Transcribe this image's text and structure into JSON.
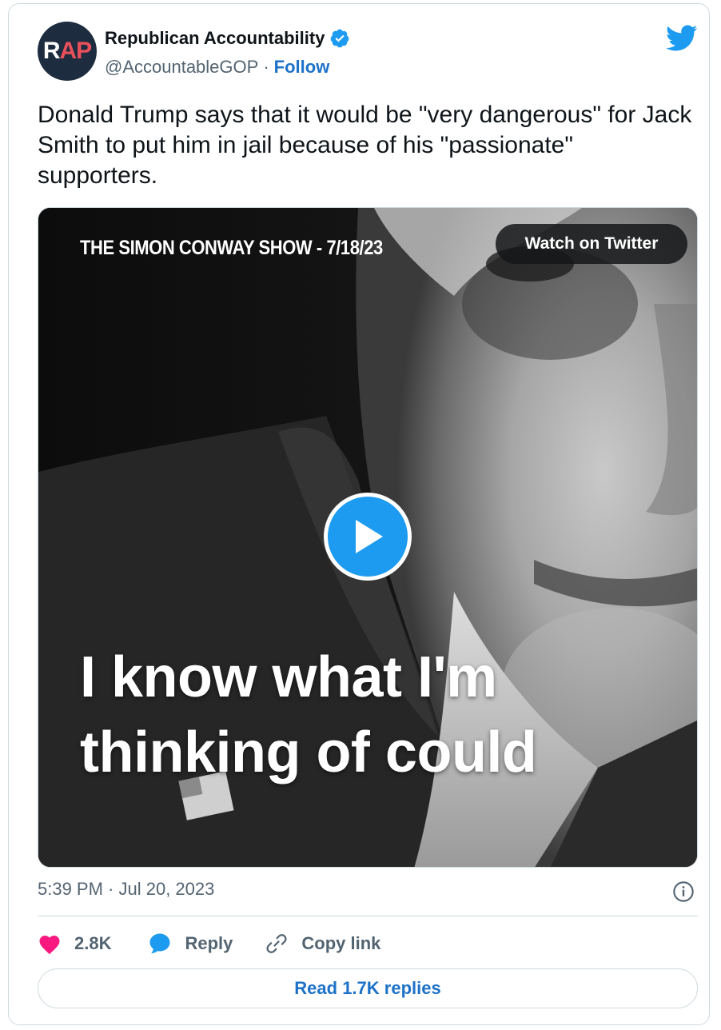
{
  "author": {
    "avatar_left": "R",
    "avatar_right": "AP",
    "display_name": "Republican Accountability",
    "handle": "@AccountableGOP",
    "separator": "·",
    "follow_label": "Follow"
  },
  "tweet": {
    "text": "Donald Trump says that it would be \"very dangerous\" for Jack Smith to put him in jail because of his \"passionate\" supporters.",
    "timestamp": "5:39 PM · Jul 20, 2023"
  },
  "media": {
    "show_title": "THE SIMON CONWAY SHOW - 7/18/23",
    "watch_label": "Watch on Twitter",
    "caption": "I know what I'm thinking of could"
  },
  "actions": {
    "likes": "2.8K",
    "reply_label": "Reply",
    "copy_label": "Copy link",
    "read_replies_label": "Read 1.7K replies"
  },
  "colors": {
    "link_blue": "#1d72c8",
    "twitter_blue": "#1d9bf0",
    "like_pink": "#f91880",
    "text_dark": "#0f1419",
    "text_gray": "#536471"
  }
}
